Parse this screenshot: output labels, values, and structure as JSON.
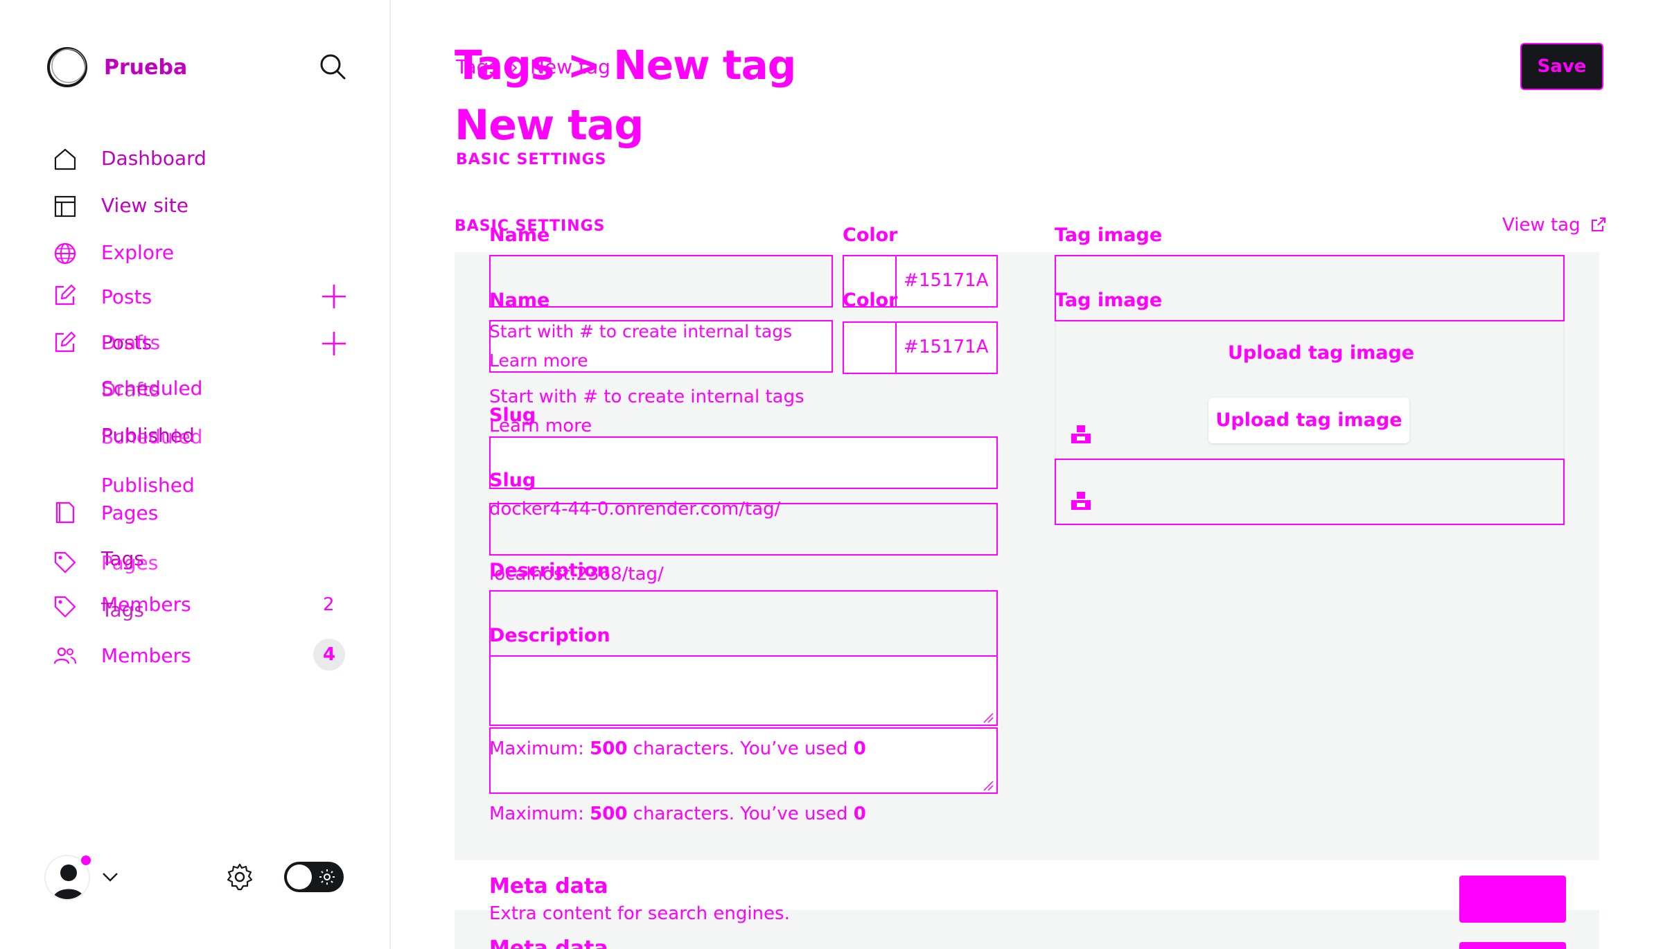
{
  "app": {
    "site_name": "Prueba"
  },
  "sidebar": {
    "items": [
      {
        "label": "Dashboard",
        "icon": "home-icon"
      },
      {
        "label": "View site",
        "icon": "layout-icon"
      },
      {
        "label": "Explore",
        "icon": "globe-icon"
      },
      {
        "label": "Posts",
        "icon": "edit-icon"
      },
      {
        "label": "Drafts",
        "icon": "edit-icon"
      },
      {
        "label": "Scheduled"
      },
      {
        "label": "Published"
      },
      {
        "label": "Pages",
        "icon": "page-icon"
      },
      {
        "label": "Tags",
        "icon": "tag-icon"
      },
      {
        "label": "Members",
        "icon": "members-icon"
      }
    ],
    "ghost_labels": {
      "posts_overlay": "Posts",
      "drafts_overlay": "Drafts",
      "scheduled_overlay": "Scheduled",
      "published_overlay": "Published",
      "pages_overlay": "Pages",
      "members_overlay": "Members"
    },
    "badges": {
      "members_ghost": "2",
      "members": "4"
    }
  },
  "header": {
    "breadcrumb_parent": "Tags",
    "breadcrumb_separator": "›",
    "breadcrumb_current": "New tag",
    "title": "New tag",
    "title_overlay": "Tags > New tag",
    "save_label": "Save"
  },
  "form": {
    "section_title": "BASIC SETTINGS",
    "name_label": "Name",
    "name_value": "",
    "name_hint": "Start with # to create internal tags Learn more",
    "color_label": "Color",
    "color_hash": "#",
    "color_value": "15171A",
    "slug_label": "Slug",
    "slug_value": "",
    "slug_url_ghost": "docker4-44-0.onrender.com/tag/",
    "slug_url": "localhost:2368/tag/",
    "description_label": "Description",
    "description_value": "",
    "description_hint_prefix": "Maximum: ",
    "description_max": "500",
    "description_hint_mid": " characters. You’ve used ",
    "description_used": "0",
    "tag_image_label": "Tag image",
    "upload_label": "Upload tag image",
    "view_tag_label": "View tag"
  },
  "meta": {
    "title": "Meta data",
    "subtitle": "Extra content for search engines."
  },
  "colors": {
    "accent": "#ff00ff",
    "panel_bg": "#f4f5f5",
    "save_bg": "#15171a",
    "toggle_bg": "#15171a"
  }
}
